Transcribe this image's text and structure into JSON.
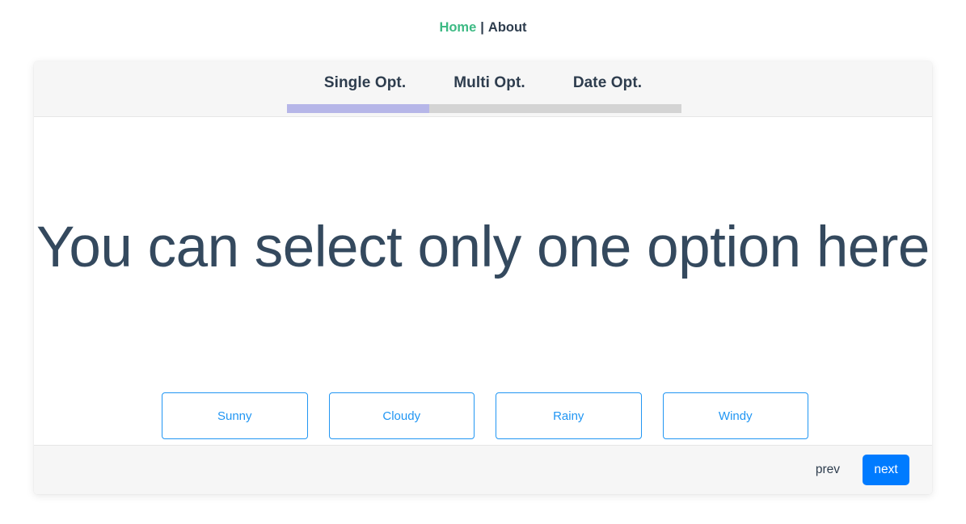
{
  "nav": {
    "home_label": "Home",
    "separator": "|",
    "about_label": "About",
    "home_color": "#3dba84",
    "about_color": "#2e3d4e"
  },
  "wizard": {
    "tabs": [
      {
        "label": "Single Opt."
      },
      {
        "label": "Multi Opt."
      },
      {
        "label": "Date Opt."
      }
    ],
    "progress": {
      "percent": 36,
      "fill_color": "#b6b6e8",
      "track_color": "#d4d4d4"
    },
    "heading": "You can select only one option here",
    "options": [
      {
        "label": "Sunny"
      },
      {
        "label": "Cloudy"
      },
      {
        "label": "Rainy"
      },
      {
        "label": "Windy"
      }
    ],
    "option_color": "#2196f3",
    "footer": {
      "prev_label": "prev",
      "next_label": "next",
      "next_color": "#007bff"
    }
  }
}
